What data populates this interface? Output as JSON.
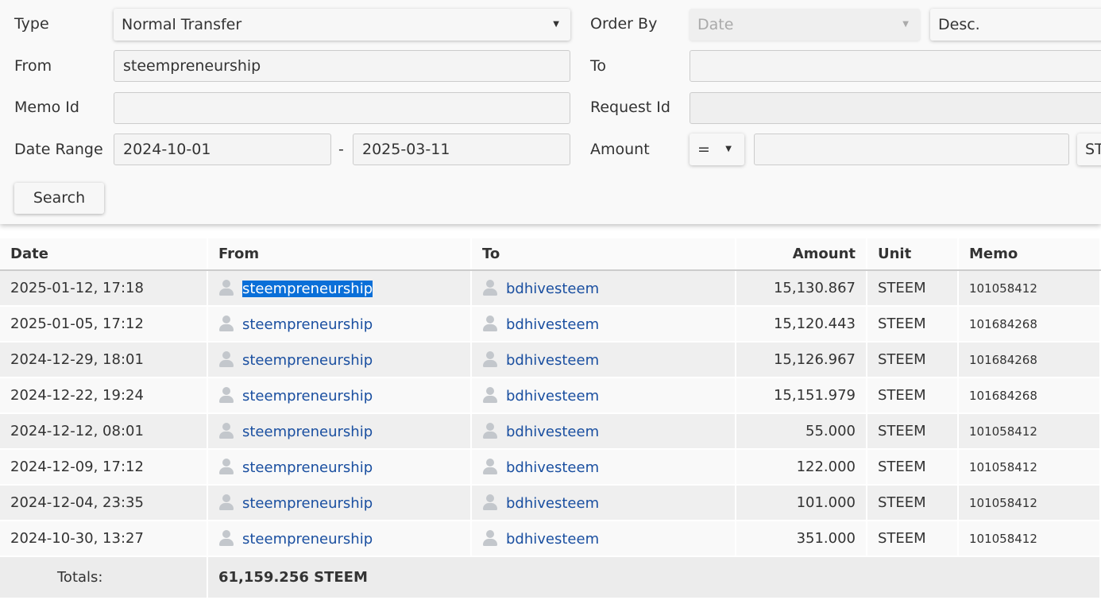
{
  "form": {
    "type_label": "Type",
    "type_value": "Normal Transfer",
    "from_label": "From",
    "from_value": "steempreneurship",
    "memo_label": "Memo Id",
    "memo_value": "",
    "date_label": "Date Range",
    "date_from": "2024-10-01",
    "date_sep": "-",
    "date_to": "2025-03-11",
    "orderby_label": "Order By",
    "orderby_value": "Date",
    "order_dir": "Desc.",
    "to_label": "To",
    "to_value": "",
    "request_label": "Request Id",
    "request_value": "",
    "amount_label": "Amount",
    "amount_op": "=",
    "amount_value": "",
    "amount_unit": "ST",
    "search_label": "Search"
  },
  "table": {
    "headers": [
      "Date",
      "From",
      "To",
      "Amount",
      "Unit",
      "Memo"
    ],
    "rows": [
      [
        "2025-01-12, 17:18",
        "steempreneurship",
        "bdhivesteem",
        "15,130.867",
        "STEEM",
        "101058412"
      ],
      [
        "2025-01-05, 17:12",
        "steempreneurship",
        "bdhivesteem",
        "15,120.443",
        "STEEM",
        "101684268"
      ],
      [
        "2024-12-29, 18:01",
        "steempreneurship",
        "bdhivesteem",
        "15,126.967",
        "STEEM",
        "101684268"
      ],
      [
        "2024-12-22, 19:24",
        "steempreneurship",
        "bdhivesteem",
        "15,151.979",
        "STEEM",
        "101684268"
      ],
      [
        "2024-12-12, 08:01",
        "steempreneurship",
        "bdhivesteem",
        "55.000",
        "STEEM",
        "101058412"
      ],
      [
        "2024-12-09, 17:12",
        "steempreneurship",
        "bdhivesteem",
        "122.000",
        "STEEM",
        "101058412"
      ],
      [
        "2024-12-04, 23:35",
        "steempreneurship",
        "bdhivesteem",
        "101.000",
        "STEEM",
        "101058412"
      ],
      [
        "2024-10-30, 13:27",
        "steempreneurship",
        "bdhivesteem",
        "351.000",
        "STEEM",
        "101058412"
      ]
    ],
    "totals_label": "Totals:",
    "totals_value": "61,159.256 STEEM"
  },
  "colors": {
    "link": "#1a4fa0",
    "selection": "#0a6fd8"
  }
}
